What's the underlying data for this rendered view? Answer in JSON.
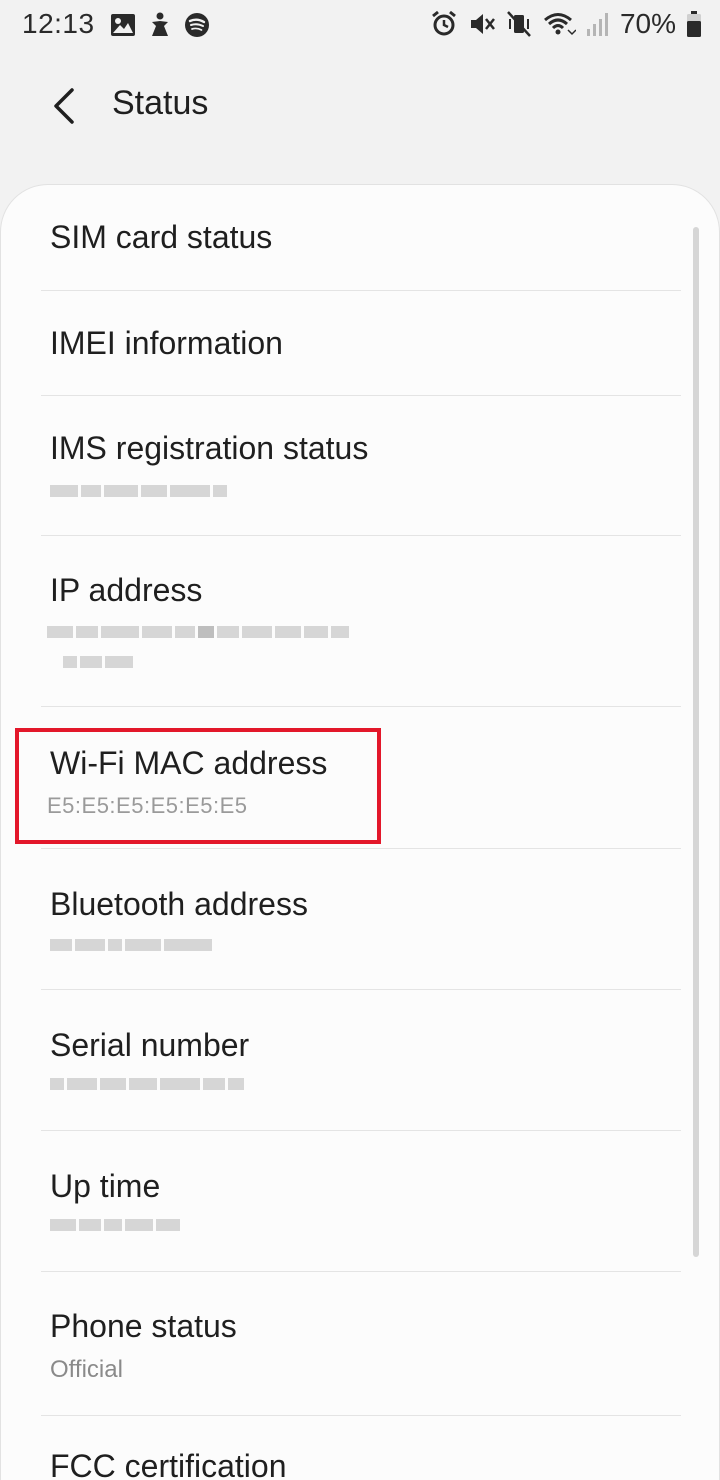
{
  "status_bar": {
    "time": "12:13",
    "battery_percent": "70%",
    "left_icons": [
      "image-icon",
      "accessibility-icon",
      "spotify-icon"
    ],
    "right_icons": [
      "alarm-icon",
      "mute-icon",
      "vibrate-off-icon",
      "wifi-icon",
      "signal-icon",
      "battery-icon"
    ]
  },
  "app_bar": {
    "title": "Status",
    "back_icon": "chevron-left-icon"
  },
  "list": {
    "items": [
      {
        "title": "SIM card status",
        "subtitle": ""
      },
      {
        "title": "IMEI information",
        "subtitle": ""
      },
      {
        "title": "IMS registration status",
        "subtitle": ""
      },
      {
        "title": "IP address",
        "subtitle": ""
      },
      {
        "title": "Wi-Fi MAC address",
        "subtitle": "E5:E5:E5:E5:E5:E5"
      },
      {
        "title": "Bluetooth address",
        "subtitle": ""
      },
      {
        "title": "Serial number",
        "subtitle": ""
      },
      {
        "title": "Up time",
        "subtitle": ""
      },
      {
        "title": "Phone status",
        "subtitle": "Official"
      },
      {
        "title": "FCC certification",
        "subtitle": ""
      }
    ]
  },
  "colors": {
    "background": "#f2f2f2",
    "card": "#fcfcfc",
    "highlight": "#e3172a",
    "subtitle": "#8a8a8a"
  }
}
